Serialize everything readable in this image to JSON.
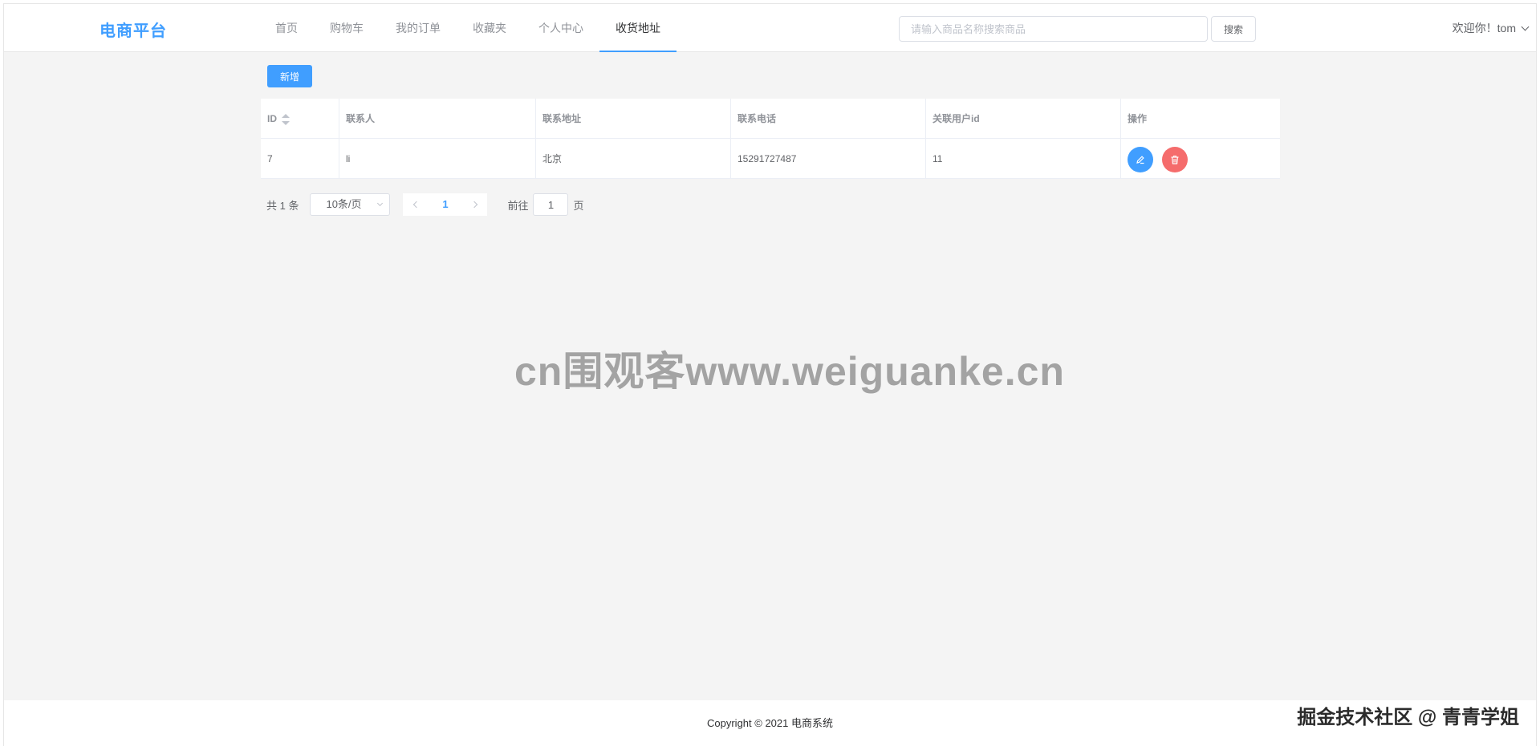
{
  "header": {
    "logo": "电商平台",
    "nav": [
      {
        "label": "首页",
        "active": false
      },
      {
        "label": "购物车",
        "active": false
      },
      {
        "label": "我的订单",
        "active": false
      },
      {
        "label": "收藏夹",
        "active": false
      },
      {
        "label": "个人中心",
        "active": false
      },
      {
        "label": "收货地址",
        "active": true
      }
    ],
    "search": {
      "placeholder": "请输入商品名称搜索商品",
      "value": "",
      "button_label": "搜索"
    },
    "user_greeting": "欢迎你！tom"
  },
  "toolbar": {
    "add_label": "新增"
  },
  "table": {
    "headers": [
      "ID",
      "联系人",
      "联系地址",
      "联系电话",
      "关联用户id",
      "操作"
    ],
    "rows": [
      {
        "id": "7",
        "contact": "li",
        "address": "北京",
        "phone": "15291727487",
        "user_id": "11"
      }
    ],
    "actions": {
      "edit_icon": "edit-icon",
      "delete_icon": "trash-icon"
    }
  },
  "pagination": {
    "total_text": "共 1 条",
    "page_size": "10条/页",
    "current_page": "1",
    "goto_label": "前往",
    "goto_value": "1",
    "goto_suffix": "页"
  },
  "watermark": "cn围观客www.weiguanke.cn",
  "footer": {
    "copyright": "Copyright © 2021 电商系统"
  },
  "credit": "掘金技术社区 @ 青青学姐",
  "colors": {
    "primary": "#409eff",
    "danger": "#f56c6c",
    "background": "#f4f4f4"
  }
}
